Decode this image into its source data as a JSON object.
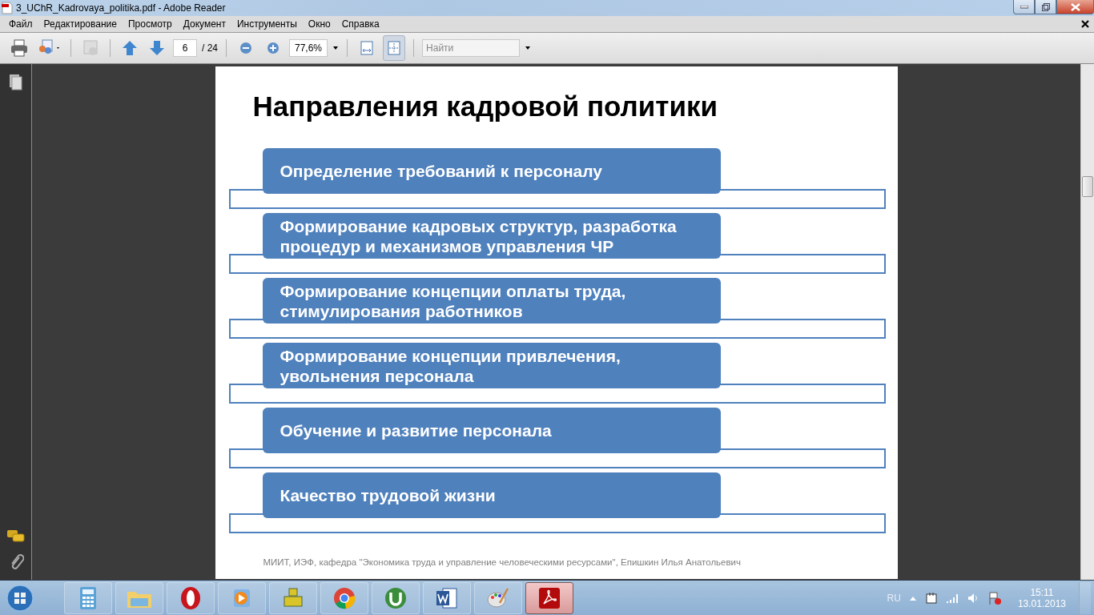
{
  "window": {
    "title": "3_UChR_Kadrovaya_politika.pdf - Adobe Reader"
  },
  "menu": [
    "Файл",
    "Редактирование",
    "Просмотр",
    "Документ",
    "Инструменты",
    "Окно",
    "Справка"
  ],
  "toolbar": {
    "page_value": "6",
    "page_total": "/ 24",
    "zoom_value": "77,6%",
    "search_placeholder": "Найти",
    "view_modes": [
      {
        "kind": "fit-width",
        "selected": false
      },
      {
        "kind": "fit-page",
        "selected": true
      }
    ]
  },
  "slide": {
    "title": "Направления кадровой политики",
    "items": [
      {
        "text": "Определение требований к персоналу"
      },
      {
        "text": "Формирование кадровых структур, разработка\nпроцедур и механизмов управления ЧР"
      },
      {
        "text": "Формирование концепции оплаты труда,\nстимулирования работников"
      },
      {
        "text": "Формирование концепции привлечения,\nувольнения персонала"
      },
      {
        "text": "Обучение и развитие персонала"
      },
      {
        "text": "Качество трудовой жизни"
      }
    ],
    "footer": "МИИТ, ИЭФ, кафедра \"Экономика труда и управление человеческими ресурсами\", Епишкин Илья Анатольевич"
  },
  "taskbar": {
    "apps": [
      {
        "kind": "calculator",
        "active": false
      },
      {
        "kind": "explorer",
        "active": false
      },
      {
        "kind": "opera",
        "active": false
      },
      {
        "kind": "media",
        "active": false
      },
      {
        "kind": "qip",
        "active": false
      },
      {
        "kind": "chrome",
        "active": false
      },
      {
        "kind": "torrent",
        "active": false
      },
      {
        "kind": "word",
        "active": false
      },
      {
        "kind": "paint",
        "active": false
      },
      {
        "kind": "acrobat",
        "active": true
      }
    ],
    "language": "RU",
    "time": "15:11",
    "date": "13.01.2013"
  }
}
